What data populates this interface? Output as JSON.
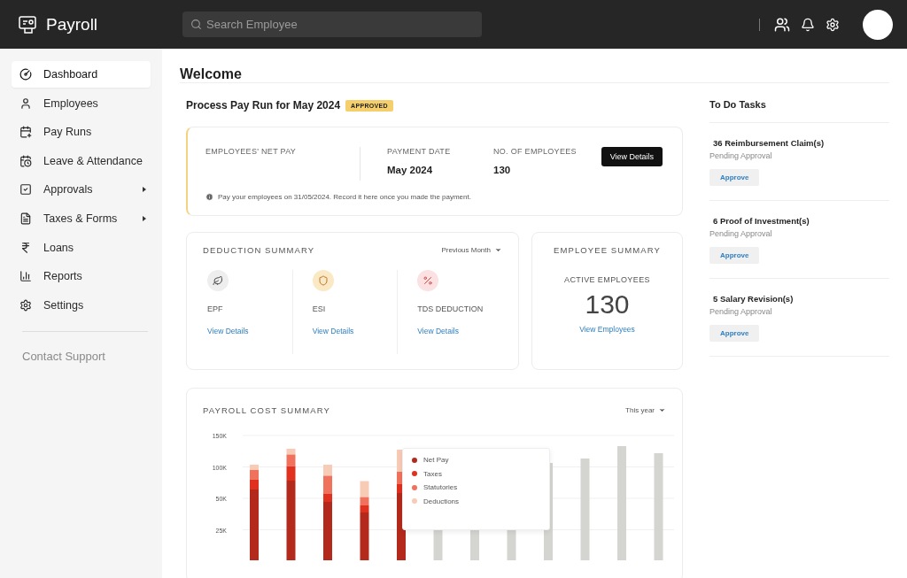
{
  "topbar": {
    "app_name": "Payroll",
    "search": {
      "placeholder": "Search Employee"
    }
  },
  "sidebar": {
    "items": [
      {
        "label": "Dashboard",
        "selected": true,
        "submenu": false
      },
      {
        "label": "Employees",
        "selected": false,
        "submenu": false
      },
      {
        "label": "Pay Runs",
        "selected": false,
        "submenu": false
      },
      {
        "label": "Leave & Attendance",
        "selected": false,
        "submenu": false
      },
      {
        "label": "Approvals",
        "selected": false,
        "submenu": true
      },
      {
        "label": "Taxes & Forms",
        "selected": false,
        "submenu": true
      },
      {
        "label": "Loans",
        "selected": false,
        "submenu": false
      },
      {
        "label": "Reports",
        "selected": false,
        "submenu": false
      },
      {
        "label": "Settings",
        "selected": false,
        "submenu": false
      }
    ],
    "footer_link": "Contact Support"
  },
  "page": {
    "title": "Welcome"
  },
  "pay_run": {
    "title": "Process Pay Run for May 2024",
    "status": "APPROVED",
    "fields": [
      {
        "label": "EMPLOYEES' NET PAY"
      },
      {
        "label": "PAYMENT DATE",
        "value": "May 2024"
      },
      {
        "label": "NO. OF EMPLOYEES",
        "value": "130"
      }
    ],
    "button": "View Details",
    "note": "Pay your employees on 31/05/2024. Record it here once you made the payment."
  },
  "deduction_summary": {
    "title": "DEDUCTION SUMMARY",
    "period": "Previous Month",
    "items": [
      {
        "label": "EPF",
        "link": "View Details"
      },
      {
        "label": "ESI",
        "link": "View Details"
      },
      {
        "label": "TDS DEDUCTION",
        "link": "View Details"
      }
    ]
  },
  "employee_summary": {
    "title": "EMPLOYEE SUMMARY",
    "label": "ACTIVE EMPLOYEES",
    "count": "130",
    "link": "View Employees"
  },
  "payroll_cost": {
    "title": "PAYROLL COST SUMMARY",
    "period": "This year",
    "y_axis_labels": [
      "150K",
      "100K",
      "50K",
      "25K"
    ],
    "tooltip": {
      "items": [
        {
          "label": "Net Pay",
          "color": "#b3291b"
        },
        {
          "label": "Taxes",
          "color": "#e0301e"
        },
        {
          "label": "Statutories",
          "color": "#f0725c"
        },
        {
          "label": "Deductions",
          "color": "#f8cbb6"
        }
      ]
    }
  },
  "todo": {
    "title": "To Do Tasks",
    "tasks": [
      {
        "title": "36 Reimbursement Claim(s)",
        "status": "Pending Approval",
        "action": "Approve"
      },
      {
        "title": "6 Proof of Investment(s)",
        "status": "Pending Approval",
        "action": "Approve"
      },
      {
        "title": "5 Salary Revision(s)",
        "status": "Pending Approval",
        "action": "Approve"
      }
    ]
  }
}
